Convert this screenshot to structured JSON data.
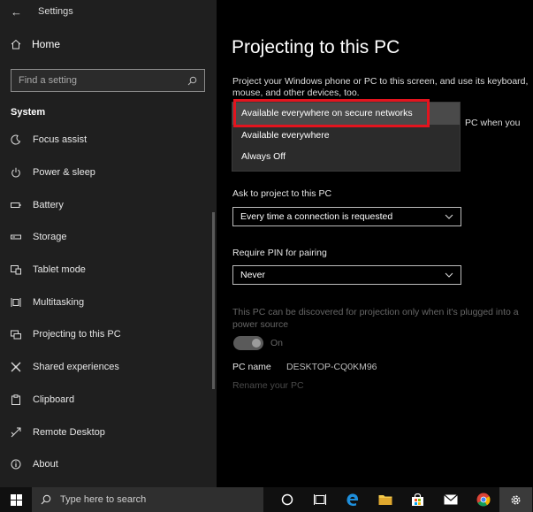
{
  "window": {
    "title": "Settings"
  },
  "sidebar": {
    "home_label": "Home",
    "search_placeholder": "Find a setting",
    "section_label": "System",
    "items": [
      {
        "label": "Focus assist",
        "icon": "moon-icon"
      },
      {
        "label": "Power & sleep",
        "icon": "power-icon"
      },
      {
        "label": "Battery",
        "icon": "battery-icon"
      },
      {
        "label": "Storage",
        "icon": "storage-icon"
      },
      {
        "label": "Tablet mode",
        "icon": "tablet-icon"
      },
      {
        "label": "Multitasking",
        "icon": "multitasking-icon"
      },
      {
        "label": "Projecting to this PC",
        "icon": "projecting-icon"
      },
      {
        "label": "Shared experiences",
        "icon": "shared-icon"
      },
      {
        "label": "Clipboard",
        "icon": "clipboard-icon"
      },
      {
        "label": "Remote Desktop",
        "icon": "remote-icon"
      },
      {
        "label": "About",
        "icon": "info-icon"
      }
    ]
  },
  "main": {
    "title": "Projecting to this PC",
    "description_line1": "Project your Windows phone or PC to this screen, and use its keyboard,",
    "description_line2": "mouse, and other devices, too.",
    "description_tail": "PC when you",
    "availability_options": [
      "Available everywhere on secure networks",
      "Available everywhere",
      "Always Off"
    ],
    "ask_label": "Ask to project to this PC",
    "ask_value": "Every time a connection is requested",
    "pin_label": "Require PIN for pairing",
    "pin_value": "Never",
    "power_note": "This PC can be discovered for projection only when it's plugged into a power source",
    "toggle_state": "On",
    "pcname_label": "PC name",
    "pcname_value": "DESKTOP-CQ0KM96",
    "rename_label": "Rename your PC"
  },
  "taskbar": {
    "search_placeholder": "Type here to search",
    "icons": [
      "cortana-icon",
      "task-view-icon",
      "edge-icon",
      "file-explorer-icon",
      "store-icon",
      "mail-icon",
      "chrome-icon",
      "settings-icon"
    ]
  },
  "colors": {
    "highlight": "#e3141e"
  }
}
